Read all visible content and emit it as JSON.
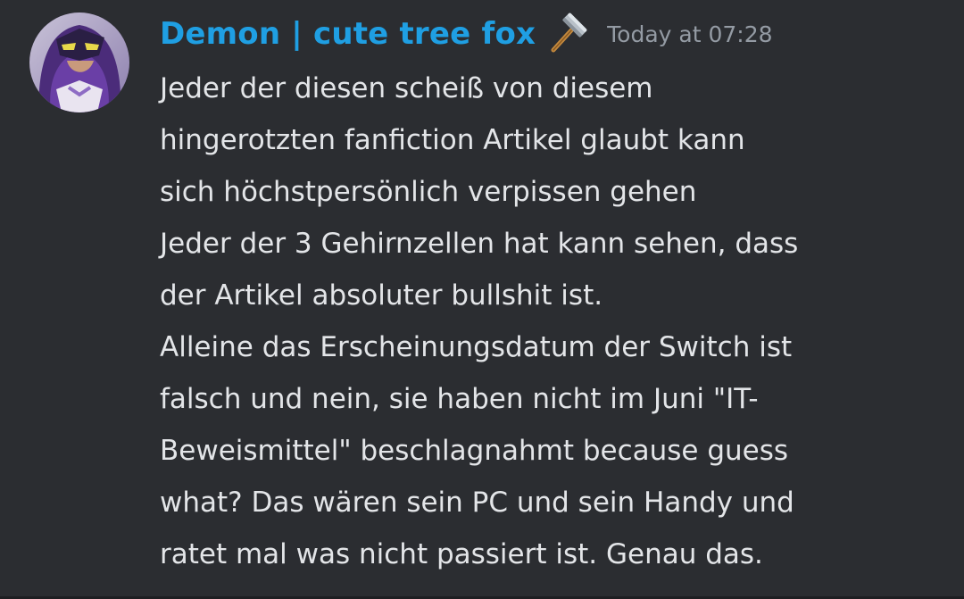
{
  "message": {
    "author": "Demon | cute tree fox",
    "author_color": "#1f9fe3",
    "badge_icon": "hammer-icon",
    "timestamp": "Today at 07:28",
    "avatar": "avatar",
    "lines": [
      "Jeder der diesen scheiß von diesem",
      "hingerotzten fanfiction Artikel glaubt kann",
      "sich höchstpersönlich verpissen gehen",
      "Jeder der 3 Gehirnzellen hat kann sehen, dass",
      "der Artikel absoluter bullshit ist.",
      "Alleine das Erscheinungsdatum der Switch ist",
      "falsch und nein, sie haben nicht im Juni \"IT-",
      "Beweismittel\" beschlagnahmt because guess",
      "what? Das wären sein PC und sein Handy und",
      "ratet mal was nicht passiert ist. Genau das."
    ]
  },
  "theme": {
    "background": "#2b2d31",
    "text_color": "#e3e5e8",
    "timestamp_color": "#949ba4"
  }
}
